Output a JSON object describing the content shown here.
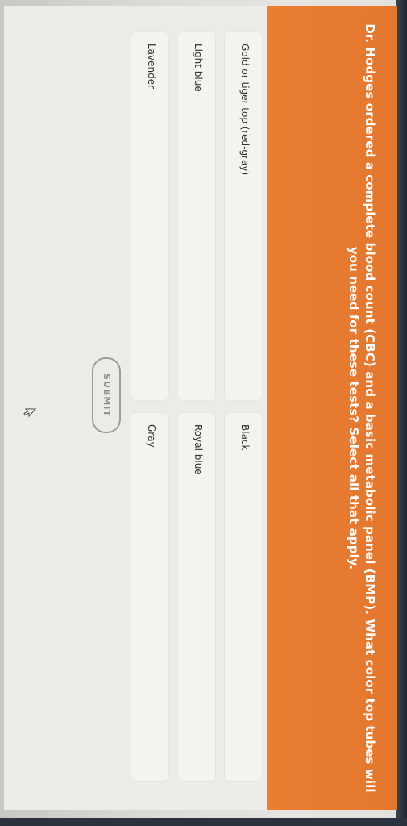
{
  "question": {
    "text": "Dr. Hodges ordered a complete blood count (CBC) and a basic metabolic panel (BMP). What color top tubes will you need for these tests? Select all that apply."
  },
  "options": [
    {
      "label": "Gold or tiger top (red-gray)"
    },
    {
      "label": "Black"
    },
    {
      "label": "Light blue"
    },
    {
      "label": "Royal blue"
    },
    {
      "label": "Lavender"
    },
    {
      "label": "Gray"
    }
  ],
  "submit": {
    "label": "SUBMIT"
  },
  "colors": {
    "banner": "#e97e33",
    "card": "#ecebe8",
    "option": "#f4f3f0"
  },
  "icons": {
    "cursor": "mouse-pointer-icon"
  }
}
